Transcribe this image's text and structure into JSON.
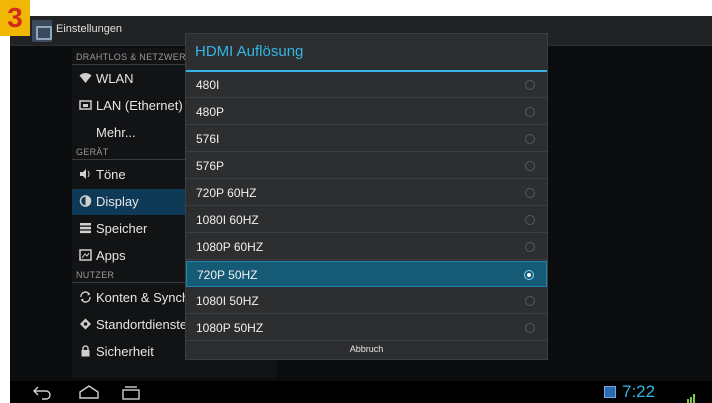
{
  "badge": {
    "number": "3"
  },
  "action_bar": {
    "title": "Einstellungen"
  },
  "sidebar": {
    "sections": [
      {
        "header": "DRAHTLOS & NETZWERKE"
      },
      {
        "header": "GERÄT"
      },
      {
        "header": "NUTZER"
      }
    ],
    "items": [
      {
        "label": "WLAN",
        "icon": "wifi-icon"
      },
      {
        "label": "LAN (Ethernet)",
        "icon": "ethernet-icon"
      },
      {
        "label": "Mehr...",
        "icon": ""
      },
      {
        "label": "Töne",
        "icon": "speaker-icon"
      },
      {
        "label": "Display",
        "icon": "brightness-icon",
        "selected": true
      },
      {
        "label": "Speicher",
        "icon": "storage-icon"
      },
      {
        "label": "Apps",
        "icon": "apps-icon"
      },
      {
        "label": "Konten & Synchronisierung",
        "icon": "sync-icon"
      },
      {
        "label": "Standortdienste",
        "icon": "location-icon"
      },
      {
        "label": "Sicherheit",
        "icon": "lock-icon"
      }
    ]
  },
  "dialog": {
    "title": "HDMI Auflösung",
    "options": [
      {
        "label": "480I",
        "checked": false
      },
      {
        "label": "480P",
        "checked": false
      },
      {
        "label": "576I",
        "checked": false
      },
      {
        "label": "576P",
        "checked": false
      },
      {
        "label": "720P 60HZ",
        "checked": false
      },
      {
        "label": "1080I 60HZ",
        "checked": false
      },
      {
        "label": "1080P 60HZ",
        "checked": false
      },
      {
        "label": "720P 50HZ",
        "checked": true
      },
      {
        "label": "1080I 50HZ",
        "checked": false
      },
      {
        "label": "1080P 50HZ",
        "checked": false
      }
    ],
    "cancel_label": "Abbruch"
  },
  "nav_bar": {
    "buttons": [
      "back-icon",
      "home-icon",
      "recent-apps-icon"
    ],
    "clock": "7:22"
  },
  "colors": {
    "accent": "#33b5e5",
    "selected_row": "#155b75",
    "badge": "#f2b705"
  }
}
